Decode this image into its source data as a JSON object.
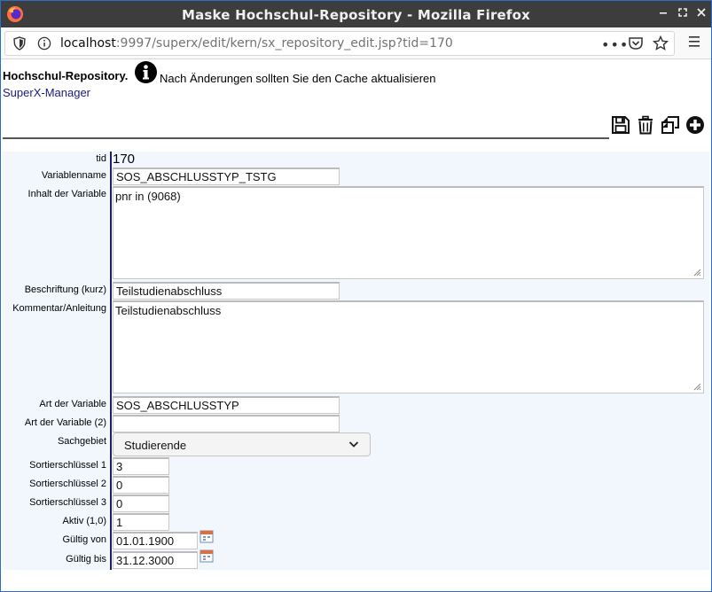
{
  "window": {
    "title": "Maske Hochschul-Repository - Mozilla Firefox"
  },
  "urlbar": {
    "host": "localhost",
    "rest": ":9997/superx/edit/kern/sx_repository_edit.jsp?tid=170",
    "more": "•••"
  },
  "header": {
    "title": "Hochschul-Repository.",
    "message": "Nach Änderungen sollten Sie den Cache aktualisieren",
    "link": "SuperX-Manager"
  },
  "form": {
    "tid": {
      "label": "tid",
      "value": "170"
    },
    "variablenname": {
      "label": "Variablenname",
      "value": "SOS_ABSCHLUSSTYP_TSTG"
    },
    "inhalt": {
      "label": "Inhalt der Variable",
      "value": "pnr in (9068)"
    },
    "beschriftung": {
      "label": "Beschriftung (kurz)",
      "value": "Teilstudienabschluss"
    },
    "kommentar": {
      "label": "Kommentar/Anleitung",
      "value": "Teilstudienabschluss"
    },
    "art": {
      "label": "Art der Variable",
      "value": "SOS_ABSCHLUSSTYP"
    },
    "art2": {
      "label": "Art der Variable (2)",
      "value": ""
    },
    "sachgebiet": {
      "label": "Sachgebiet",
      "value": "Studierende"
    },
    "sort1": {
      "label": "Sortierschlüssel 1",
      "value": "3"
    },
    "sort2": {
      "label": "Sortierschlüssel 2",
      "value": "0"
    },
    "sort3": {
      "label": "Sortierschlüssel 3",
      "value": "0"
    },
    "aktiv": {
      "label": "Aktiv (1,0)",
      "value": "1"
    },
    "gueltig_von": {
      "label": "Gültig von",
      "value": "01.01.1900"
    },
    "gueltig_bis": {
      "label": "Gültig bis",
      "value": "31.12.3000"
    }
  }
}
